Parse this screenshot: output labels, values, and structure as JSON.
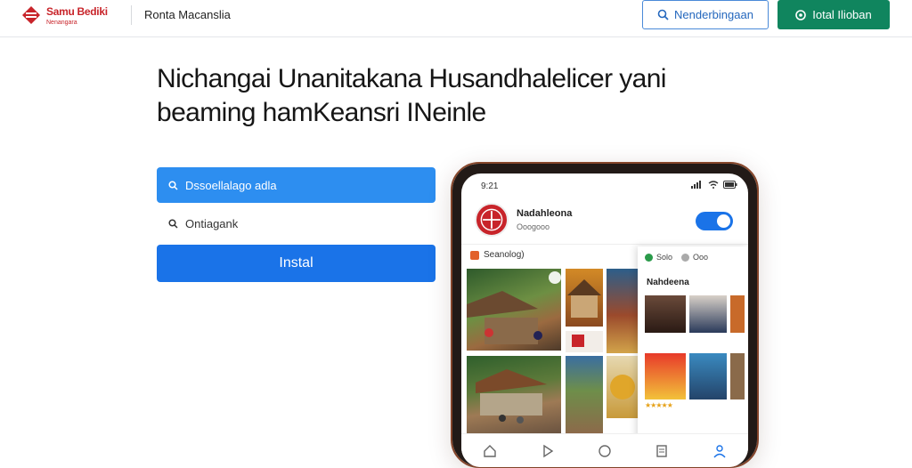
{
  "header": {
    "brand_name": "Samu Bediki",
    "brand_tagline": "Nenangara",
    "site_name": "Ronta Macanslia",
    "search_button_label": "Nenderbingaan",
    "cta_button_label": "Iotal Ilioban"
  },
  "main": {
    "headline": "Nichangai Unanitakana Husandhalelicer yani beaming hamKeansri INeinle",
    "search_field_value": "Dssoellalago adla",
    "secondary_field_value": "Ontiagank",
    "install_button_label": "Instal"
  },
  "phone": {
    "status_time": "9:21",
    "app_title": "Nadahleona",
    "app_subtitle": "Ooogooo",
    "section_label": "Seanolog)",
    "overlay_chip_1": "Solo",
    "overlay_chip_2": "Ooo",
    "overlay_title": "Nahdeena",
    "rating_stars": "★★★★★"
  },
  "colors": {
    "brand_red": "#c8242a",
    "accent_blue": "#1a73e8",
    "cta_green": "#10855e"
  },
  "icons": [
    "logo-icon",
    "search-icon",
    "plus-circle-icon",
    "signal-icon",
    "wifi-icon",
    "battery-icon",
    "home-icon",
    "play-icon",
    "circle-icon",
    "doc-icon",
    "profile-icon"
  ]
}
